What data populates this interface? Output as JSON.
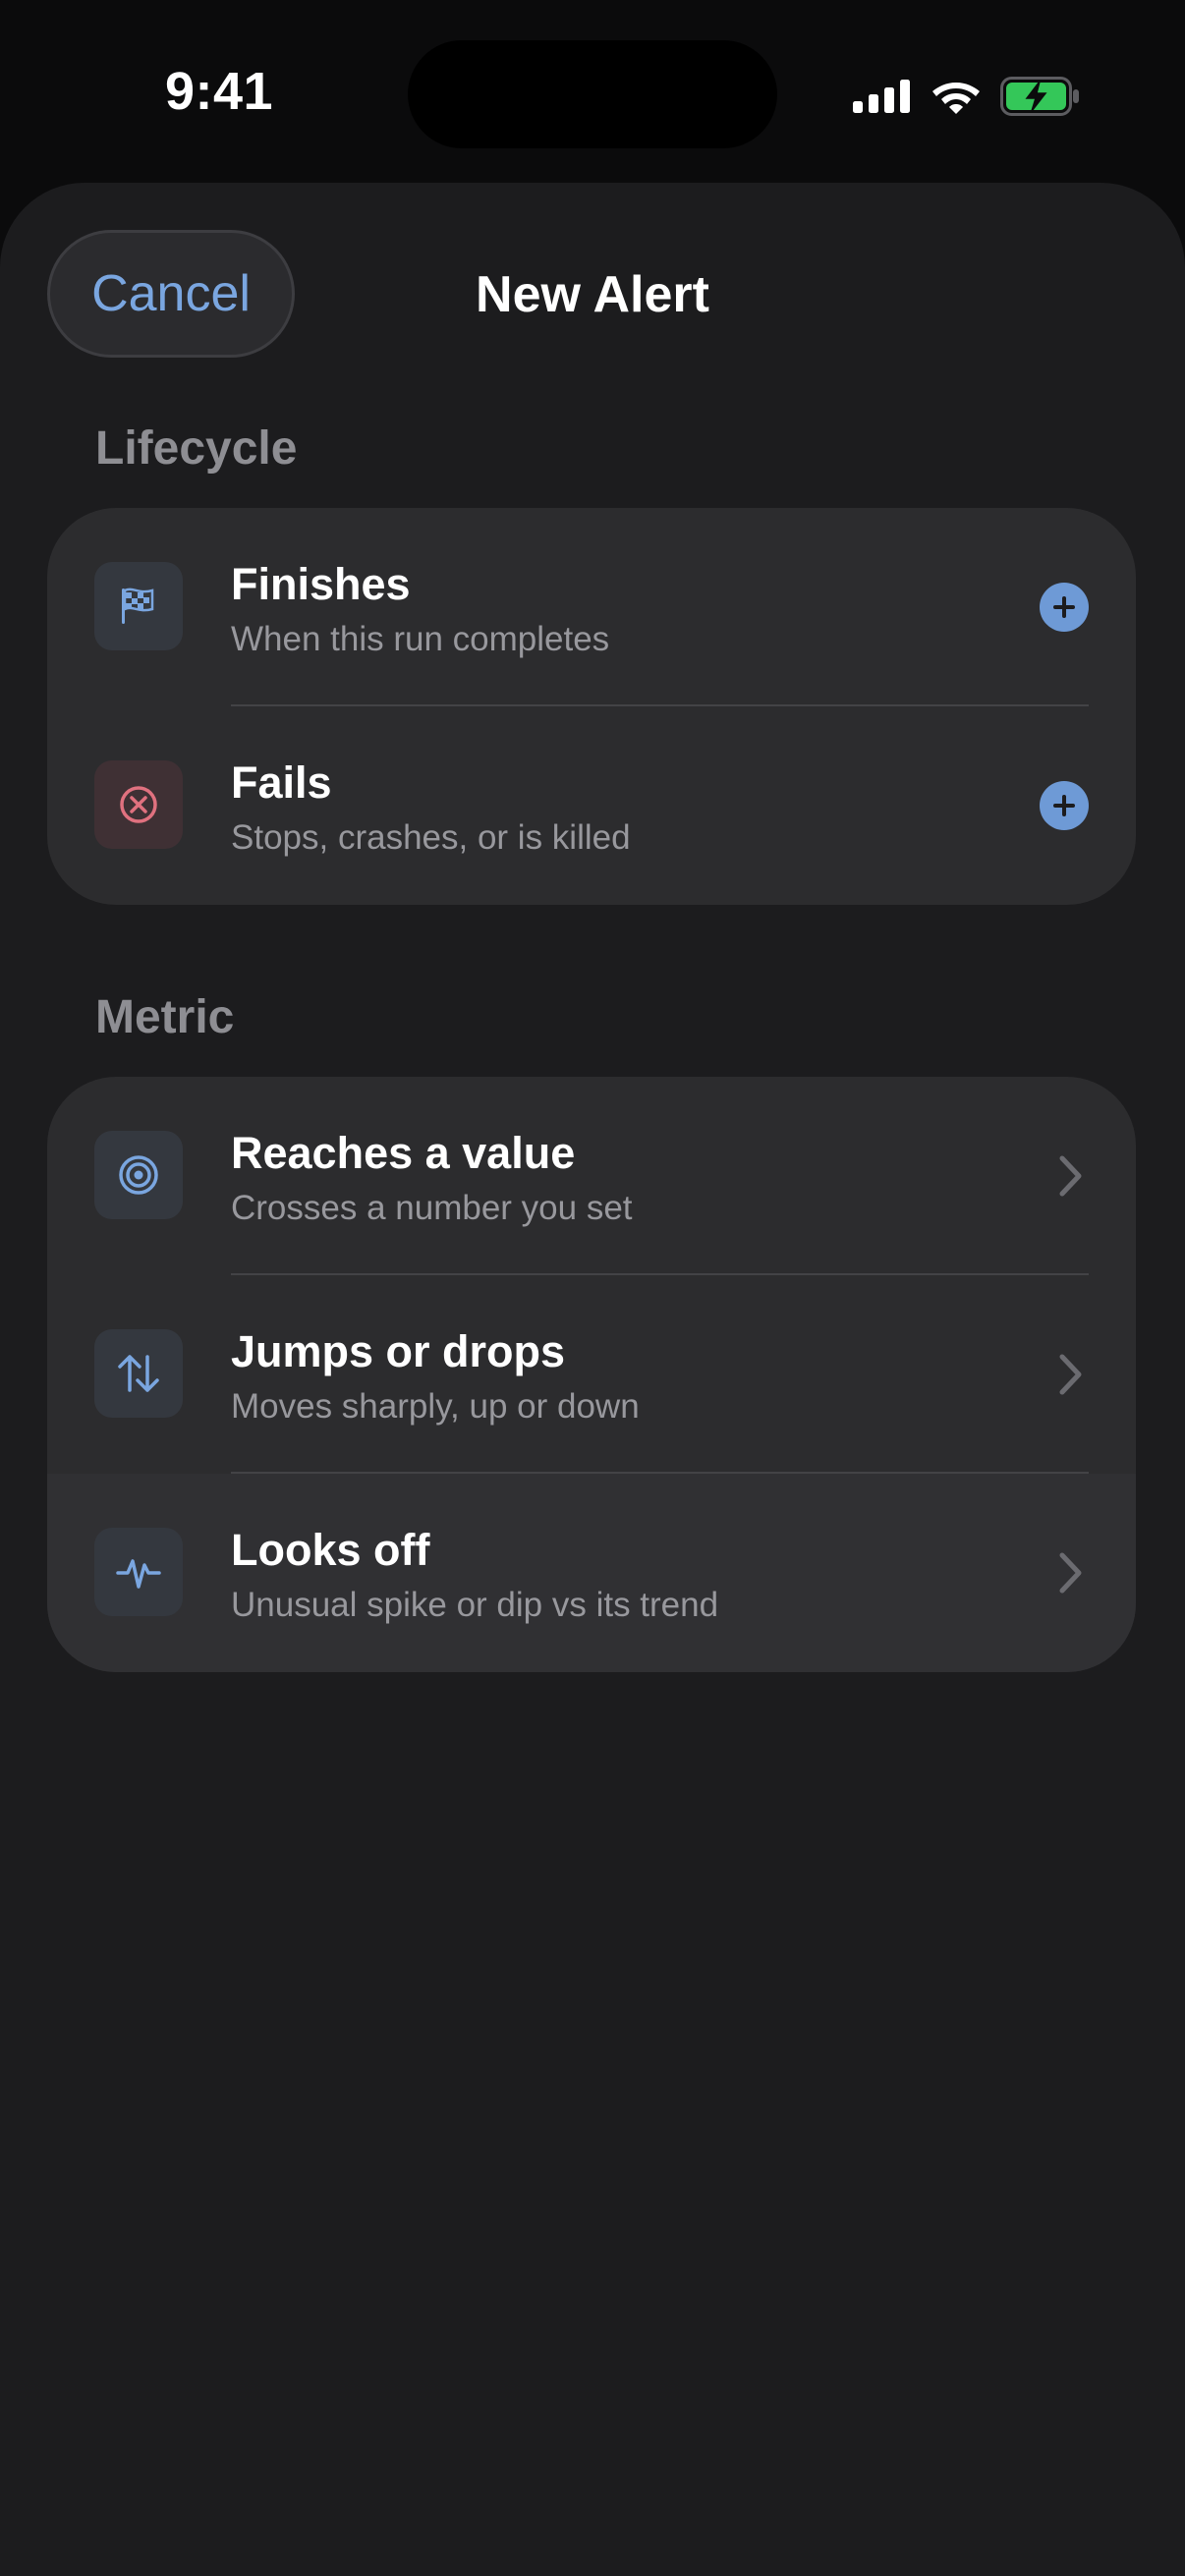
{
  "status_bar": {
    "time": "9:41",
    "icons": [
      "cellular-signal-icon",
      "wifi-icon",
      "battery-charging-icon"
    ]
  },
  "header": {
    "cancel_label": "Cancel",
    "title": "New Alert"
  },
  "sections": [
    {
      "title": "Lifecycle",
      "items": [
        {
          "title": "Finishes",
          "subtitle": "When this run completes",
          "icon": "checkered-flag-icon",
          "accessory": "add-button"
        },
        {
          "title": "Fails",
          "subtitle": "Stops, crashes, or is killed",
          "icon": "x-circle-icon",
          "accessory": "add-button"
        }
      ]
    },
    {
      "title": "Metric",
      "items": [
        {
          "title": "Reaches a value",
          "subtitle": "Crosses a number you set",
          "icon": "target-icon",
          "accessory": "chevron-right-icon"
        },
        {
          "title": "Jumps or drops",
          "subtitle": "Moves sharply, up or down",
          "icon": "up-down-arrows-icon",
          "accessory": "chevron-right-icon"
        },
        {
          "title": "Looks off",
          "subtitle": "Unusual spike or dip vs its trend",
          "icon": "pulse-icon",
          "accessory": "chevron-right-icon"
        }
      ]
    }
  ],
  "colors": {
    "accent": "#7aa6e0",
    "add_button": "#6e9ad6",
    "danger_icon": "#e0717f",
    "battery": "#34c759",
    "sheet_background": "#1c1c1e",
    "card_background": "#2c2c2e"
  }
}
